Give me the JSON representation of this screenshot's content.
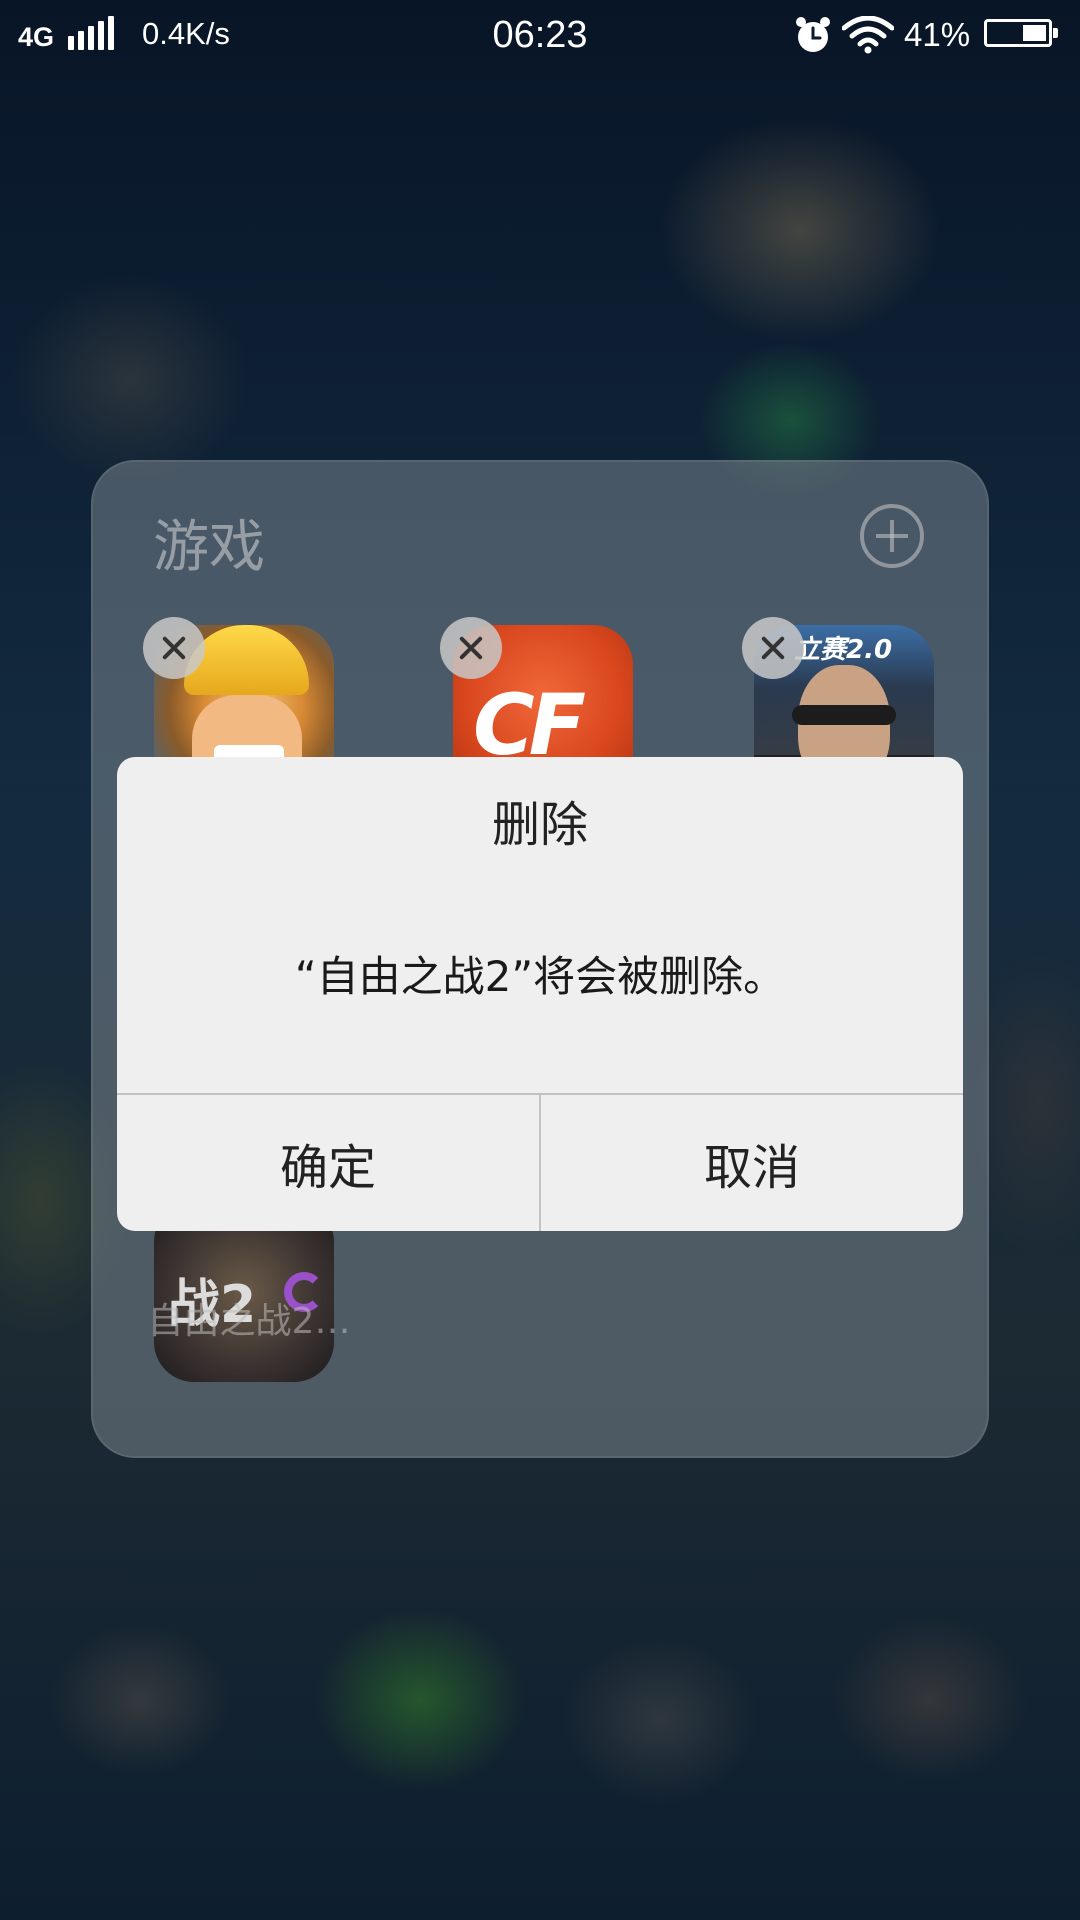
{
  "status_bar": {
    "network": "4G",
    "net_speed": "0.4K/s",
    "time": "06:23",
    "battery_percent_text": "41%",
    "battery_level": 0.41,
    "icons": [
      "signal-icon",
      "alarm-icon",
      "wifi-icon",
      "battery-icon"
    ]
  },
  "folder": {
    "title": "游戏",
    "add_icon": "plus-circle-icon",
    "apps": [
      {
        "name": "clash-of-clans",
        "icon": "app-icon"
      },
      {
        "name": "crossfire",
        "icon": "app-icon",
        "logo_text": "CF"
      },
      {
        "name": "racing",
        "icon": "app-icon",
        "badge_text": "立赛2.0"
      },
      {
        "name": "free-war-2",
        "icon": "app-icon",
        "label": "自由之战2…"
      }
    ]
  },
  "dialog": {
    "title": "删除",
    "message": "“自由之战2”将会被删除。",
    "confirm_label": "确定",
    "cancel_label": "取消"
  },
  "colors": {
    "dialog_bg": "#efefef",
    "divider": "#c2c2c2",
    "cf_orange": "#d9471e"
  }
}
